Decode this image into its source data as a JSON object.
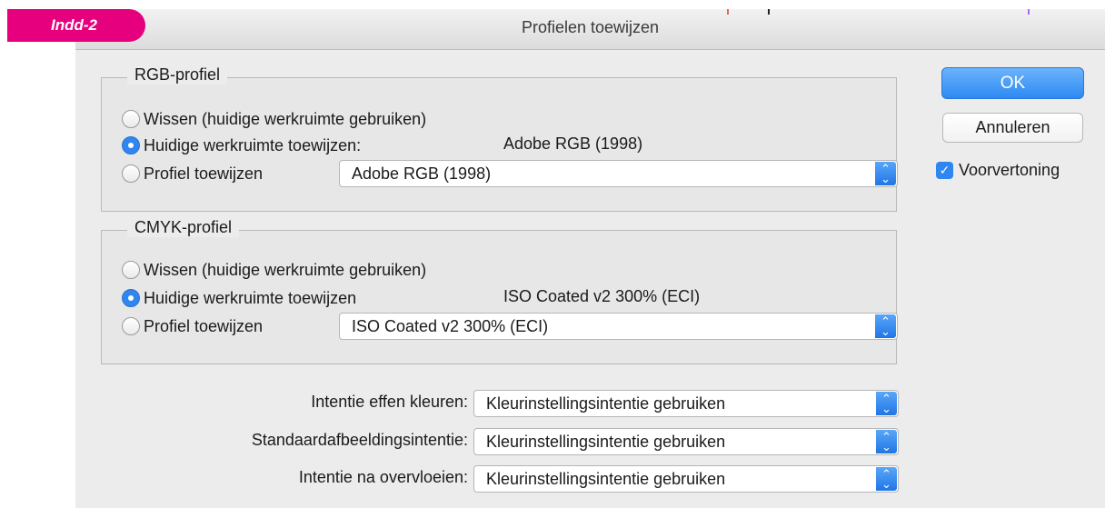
{
  "tag": "Indd-2",
  "window": {
    "title": "Profielen toewijzen"
  },
  "rgb": {
    "legend": "RGB-profiel",
    "options": [
      {
        "label": "Wissen (huidige werkruimte gebruiken)",
        "selected": false
      },
      {
        "label": "Huidige werkruimte toewijzen:",
        "selected": true,
        "value": "Adobe RGB (1998)"
      },
      {
        "label": "Profiel toewijzen",
        "selected": false
      }
    ],
    "select_value": "Adobe RGB (1998)"
  },
  "cmyk": {
    "legend": "CMYK-profiel",
    "options": [
      {
        "label": "Wissen (huidige werkruimte gebruiken)",
        "selected": false
      },
      {
        "label": "Huidige werkruimte toewijzen",
        "selected": true,
        "value": "ISO Coated v2 300% (ECI)"
      },
      {
        "label": "Profiel toewijzen",
        "selected": false
      }
    ],
    "select_value": "ISO Coated v2 300% (ECI)"
  },
  "intents": [
    {
      "label": "Intentie effen kleuren:",
      "value": "Kleurinstellingsintentie gebruiken"
    },
    {
      "label": "Standaardafbeeldingsintentie:",
      "value": "Kleurinstellingsintentie gebruiken"
    },
    {
      "label": "Intentie na overvloeien:",
      "value": "Kleurinstellingsintentie gebruiken"
    }
  ],
  "buttons": {
    "ok": "OK",
    "cancel": "Annuleren"
  },
  "preview": {
    "label": "Voorvertoning",
    "checked": true
  },
  "colors": {
    "tag": "#e6007e",
    "accent": "#2f86f0"
  },
  "icons": {
    "stepper": "up-down-chevron-icon",
    "check": "checkmark-icon",
    "radio": "radio-dot-icon"
  }
}
